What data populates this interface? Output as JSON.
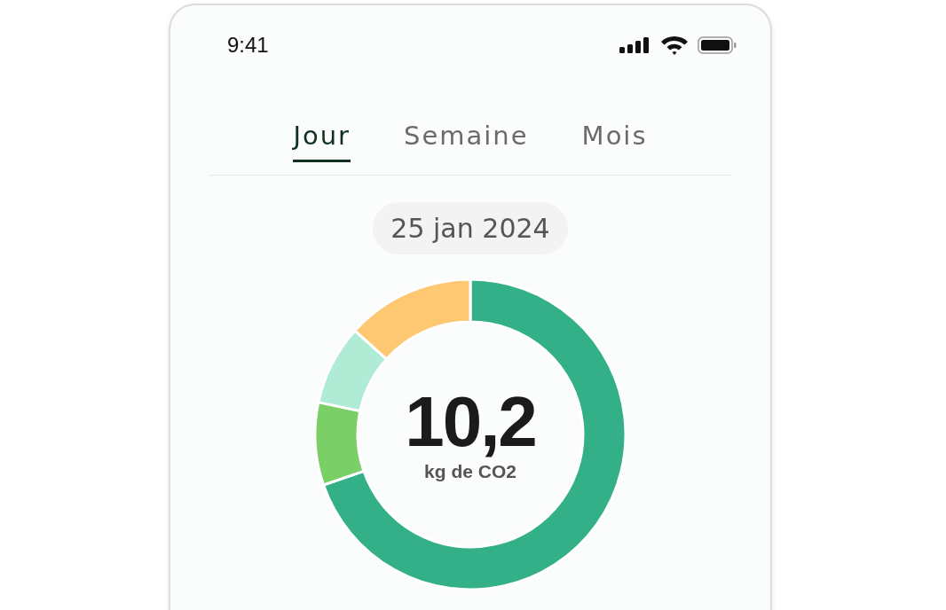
{
  "status_bar": {
    "time": "9:41"
  },
  "tabs": [
    {
      "label": "Jour",
      "selected": true
    },
    {
      "label": "Semaine",
      "selected": false
    },
    {
      "label": "Mois",
      "selected": false
    }
  ],
  "date": "25 jan 2024",
  "total": {
    "value": "10,2",
    "unit": "kg de CO2"
  }
}
